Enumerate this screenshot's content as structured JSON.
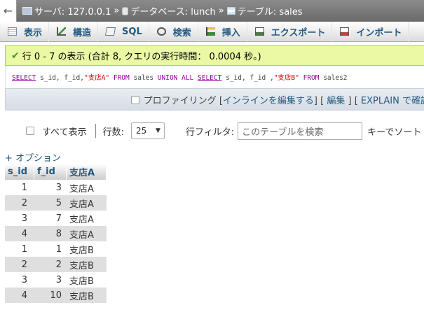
{
  "breadcrumb": {
    "back": "←",
    "server": "サーバ: 127.0.0.1",
    "database": "データベース: lunch",
    "table": "テーブル: sales",
    "separator": "»"
  },
  "tabs": [
    {
      "label": "表示",
      "icon": "browse-icon"
    },
    {
      "label": "構造",
      "icon": "structure-icon"
    },
    {
      "label": "SQL",
      "icon": "sql-icon"
    },
    {
      "label": "検索",
      "icon": "search-icon"
    },
    {
      "label": "挿入",
      "icon": "insert-icon"
    },
    {
      "label": "エクスポート",
      "icon": "export-icon"
    },
    {
      "label": "インポート",
      "icon": "import-icon"
    }
  ],
  "success": {
    "check": "✔",
    "message": "行 0 - 7 の表示 (合計 8, クエリの実行時間： 0.0004 秒。)",
    "color": "#ebf8a4"
  },
  "sql": {
    "select1": "SELECT",
    "cols1": " s_id, f_id,",
    "alias1": "\"支店A\"",
    "from1": " FROM",
    "tbl1": " sales ",
    "union": "UNION ALL",
    "select2": "SELECT",
    "cols2": " s_id, f_id ,",
    "alias2": "\"支店B\"",
    "from2": " FROM",
    "tbl2": " sales2"
  },
  "sql_options": {
    "profiling": "プロファイリング",
    "bracket_open": " [",
    "inline_edit": "インラインを編集する",
    "bracket_mid1": "] [ ",
    "edit": "編集",
    "bracket_mid2": " ] [ ",
    "explain": "EXPLAIN で確認"
  },
  "nav": {
    "show_all": "すべて表示",
    "rows_label": "行数:",
    "rows_value": "25",
    "filter_label": "行フィルタ:",
    "filter_placeholder": "このテーブルを検索",
    "key_label": "キーでソート"
  },
  "options_link": "+ オプション",
  "result": {
    "columns": [
      "s_id",
      "f_id",
      "支店A"
    ],
    "rows": [
      [
        "1",
        "3",
        "支店A"
      ],
      [
        "2",
        "5",
        "支店A"
      ],
      [
        "3",
        "7",
        "支店A"
      ],
      [
        "4",
        "8",
        "支店A"
      ],
      [
        "1",
        "1",
        "支店B"
      ],
      [
        "2",
        "2",
        "支店B"
      ],
      [
        "3",
        "3",
        "支店B"
      ],
      [
        "4",
        "10",
        "支店B"
      ]
    ]
  }
}
